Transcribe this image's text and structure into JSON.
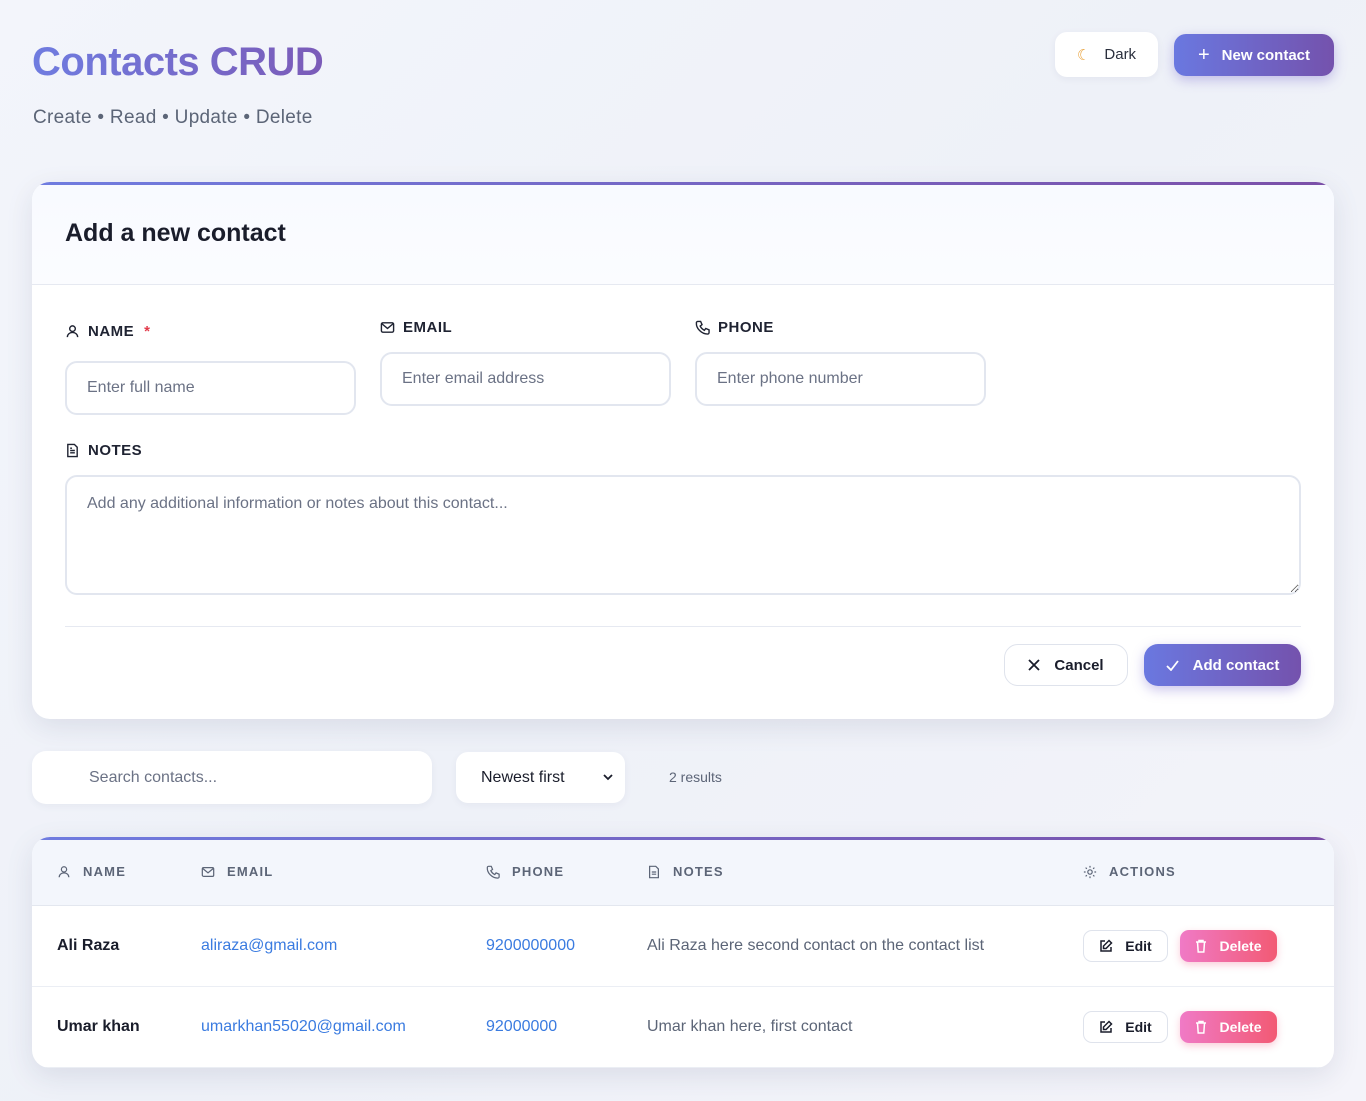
{
  "header": {
    "title": "Contacts CRUD",
    "subtitle": "Create • Read • Update • Delete",
    "theme_label": "Dark",
    "new_label": "New contact"
  },
  "form": {
    "title": "Add a new contact",
    "name_label": "NAME",
    "required_mark": "*",
    "name_placeholder": "Enter full name",
    "email_label": "EMAIL",
    "email_placeholder": "Enter email address",
    "phone_label": "PHONE",
    "phone_placeholder": "Enter phone number",
    "notes_label": "NOTES",
    "notes_placeholder": "Add any additional information or notes about this contact...",
    "cancel_label": "Cancel",
    "submit_label": "Add contact"
  },
  "toolbar": {
    "search_placeholder": "Search contacts...",
    "sort_value": "Newest first",
    "results_text": "2 results"
  },
  "table": {
    "columns": [
      "NAME",
      "EMAIL",
      "PHONE",
      "NOTES",
      "ACTIONS"
    ],
    "rows": [
      {
        "name": "Ali Raza",
        "email": "aliraza@gmail.com",
        "phone": "9200000000",
        "notes": "Ali Raza here second contact on the contact list"
      },
      {
        "name": "Umar khan",
        "email": "umarkhan55020@gmail.com",
        "phone": "92000000",
        "notes": "Umar khan here, first contact"
      }
    ],
    "edit_label": "Edit",
    "delete_label": "Delete"
  },
  "colors": {
    "accent_start": "#6a78e0",
    "accent_end": "#7452ad",
    "link": "#3a7be0",
    "danger_start": "#f07ac6",
    "danger_end": "#f25a74"
  }
}
